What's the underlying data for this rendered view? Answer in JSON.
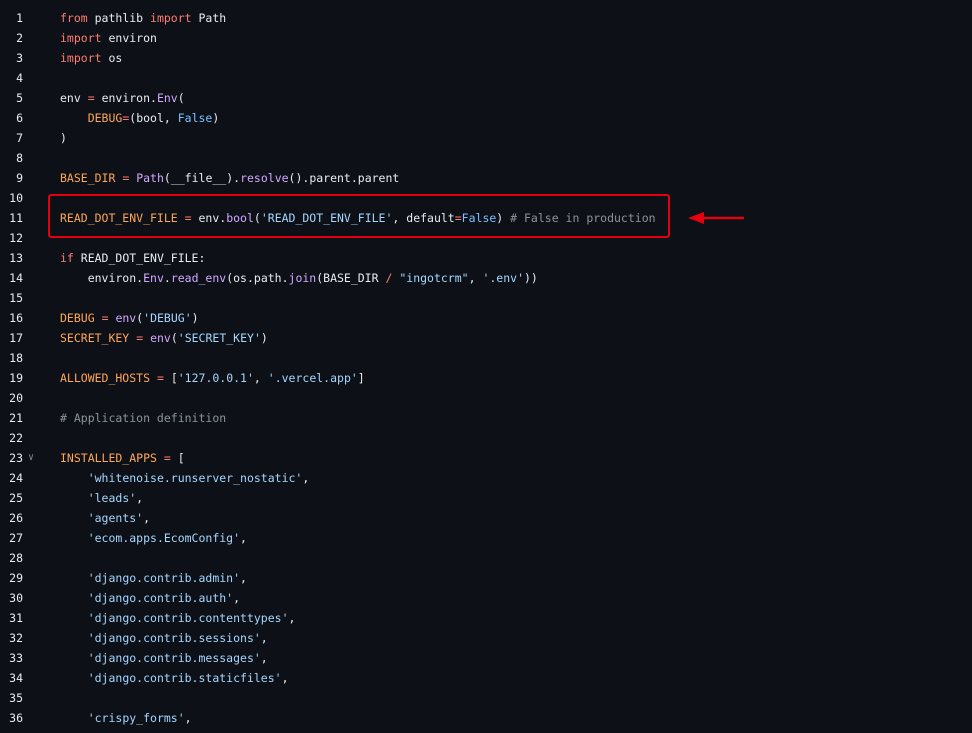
{
  "lines": [
    {
      "n": "1",
      "t": [
        [
          "kw",
          "from"
        ],
        [
          "plain",
          " pathlib "
        ],
        [
          "kw",
          "import"
        ],
        [
          "plain",
          " Path"
        ]
      ]
    },
    {
      "n": "2",
      "t": [
        [
          "kw",
          "import"
        ],
        [
          "plain",
          " environ"
        ]
      ]
    },
    {
      "n": "3",
      "t": [
        [
          "kw",
          "import"
        ],
        [
          "plain",
          " os"
        ]
      ]
    },
    {
      "n": "4",
      "t": []
    },
    {
      "n": "5",
      "t": [
        [
          "plain",
          "env "
        ],
        [
          "op",
          "="
        ],
        [
          "plain",
          " environ."
        ],
        [
          "fn",
          "Env"
        ],
        [
          "plain",
          "("
        ]
      ]
    },
    {
      "n": "6",
      "t": [
        [
          "plain",
          "    "
        ],
        [
          "var",
          "DEBUG"
        ],
        [
          "op",
          "="
        ],
        [
          "plain",
          "(bool, "
        ],
        [
          "cst",
          "False"
        ],
        [
          "plain",
          ")"
        ]
      ]
    },
    {
      "n": "7",
      "t": [
        [
          "plain",
          ")"
        ]
      ]
    },
    {
      "n": "8",
      "t": []
    },
    {
      "n": "9",
      "t": [
        [
          "var",
          "BASE_DIR"
        ],
        [
          "plain",
          " "
        ],
        [
          "op",
          "="
        ],
        [
          "plain",
          " "
        ],
        [
          "fn",
          "Path"
        ],
        [
          "plain",
          "(__file__)."
        ],
        [
          "fn",
          "resolve"
        ],
        [
          "plain",
          "().parent.parent"
        ]
      ]
    },
    {
      "n": "10",
      "t": []
    },
    {
      "n": "11",
      "t": [
        [
          "var",
          "READ_DOT_ENV_FILE"
        ],
        [
          "plain",
          " "
        ],
        [
          "op",
          "="
        ],
        [
          "plain",
          " env."
        ],
        [
          "fn",
          "bool"
        ],
        [
          "plain",
          "("
        ],
        [
          "str",
          "'READ_DOT_ENV_FILE'"
        ],
        [
          "plain",
          ", "
        ],
        [
          "plain",
          "default"
        ],
        [
          "op",
          "="
        ],
        [
          "cst",
          "False"
        ],
        [
          "plain",
          ") "
        ],
        [
          "com",
          "# False in production"
        ]
      ]
    },
    {
      "n": "12",
      "t": []
    },
    {
      "n": "13",
      "t": [
        [
          "kw",
          "if"
        ],
        [
          "plain",
          " READ_DOT_ENV_FILE:"
        ]
      ]
    },
    {
      "n": "14",
      "t": [
        [
          "plain",
          "    environ."
        ],
        [
          "fn",
          "Env"
        ],
        [
          "plain",
          "."
        ],
        [
          "fn",
          "read_env"
        ],
        [
          "plain",
          "(os.path."
        ],
        [
          "fn",
          "join"
        ],
        [
          "plain",
          "(BASE_DIR "
        ],
        [
          "op",
          "/"
        ],
        [
          "plain",
          " "
        ],
        [
          "str",
          "\"ingotcrm\""
        ],
        [
          "plain",
          ", "
        ],
        [
          "str",
          "'.env'"
        ],
        [
          "plain",
          "))"
        ]
      ]
    },
    {
      "n": "15",
      "t": []
    },
    {
      "n": "16",
      "t": [
        [
          "var",
          "DEBUG"
        ],
        [
          "plain",
          " "
        ],
        [
          "op",
          "="
        ],
        [
          "plain",
          " "
        ],
        [
          "fn",
          "env"
        ],
        [
          "plain",
          "("
        ],
        [
          "str",
          "'DEBUG'"
        ],
        [
          "plain",
          ")"
        ]
      ]
    },
    {
      "n": "17",
      "t": [
        [
          "var",
          "SECRET_KEY"
        ],
        [
          "plain",
          " "
        ],
        [
          "op",
          "="
        ],
        [
          "plain",
          " "
        ],
        [
          "fn",
          "env"
        ],
        [
          "plain",
          "("
        ],
        [
          "str",
          "'SECRET_KEY'"
        ],
        [
          "plain",
          ")"
        ]
      ]
    },
    {
      "n": "18",
      "t": []
    },
    {
      "n": "19",
      "t": [
        [
          "var",
          "ALLOWED_HOSTS"
        ],
        [
          "plain",
          " "
        ],
        [
          "op",
          "="
        ],
        [
          "plain",
          " ["
        ],
        [
          "str",
          "'127.0.0.1'"
        ],
        [
          "plain",
          ", "
        ],
        [
          "str",
          "'.vercel.app'"
        ],
        [
          "plain",
          "]"
        ]
      ]
    },
    {
      "n": "20",
      "t": []
    },
    {
      "n": "21",
      "t": [
        [
          "com",
          "# Application definition"
        ]
      ]
    },
    {
      "n": "22",
      "t": []
    },
    {
      "n": "23",
      "fold": true,
      "t": [
        [
          "var",
          "INSTALLED_APPS"
        ],
        [
          "plain",
          " "
        ],
        [
          "op",
          "="
        ],
        [
          "plain",
          " ["
        ]
      ]
    },
    {
      "n": "24",
      "t": [
        [
          "plain",
          "    "
        ],
        [
          "str",
          "'whitenoise.runserver_nostatic'"
        ],
        [
          "plain",
          ","
        ]
      ]
    },
    {
      "n": "25",
      "t": [
        [
          "plain",
          "    "
        ],
        [
          "str",
          "'leads'"
        ],
        [
          "plain",
          ","
        ]
      ]
    },
    {
      "n": "26",
      "t": [
        [
          "plain",
          "    "
        ],
        [
          "str",
          "'agents'"
        ],
        [
          "plain",
          ","
        ]
      ]
    },
    {
      "n": "27",
      "t": [
        [
          "plain",
          "    "
        ],
        [
          "str",
          "'ecom.apps.EcomConfig'"
        ],
        [
          "plain",
          ","
        ]
      ]
    },
    {
      "n": "28",
      "t": []
    },
    {
      "n": "29",
      "t": [
        [
          "plain",
          "    "
        ],
        [
          "str",
          "'django.contrib.admin'"
        ],
        [
          "plain",
          ","
        ]
      ]
    },
    {
      "n": "30",
      "t": [
        [
          "plain",
          "    "
        ],
        [
          "str",
          "'django.contrib.auth'"
        ],
        [
          "plain",
          ","
        ]
      ]
    },
    {
      "n": "31",
      "t": [
        [
          "plain",
          "    "
        ],
        [
          "str",
          "'django.contrib.contenttypes'"
        ],
        [
          "plain",
          ","
        ]
      ]
    },
    {
      "n": "32",
      "t": [
        [
          "plain",
          "    "
        ],
        [
          "str",
          "'django.contrib.sessions'"
        ],
        [
          "plain",
          ","
        ]
      ]
    },
    {
      "n": "33",
      "t": [
        [
          "plain",
          "    "
        ],
        [
          "str",
          "'django.contrib.messages'"
        ],
        [
          "plain",
          ","
        ]
      ]
    },
    {
      "n": "34",
      "t": [
        [
          "plain",
          "    "
        ],
        [
          "str",
          "'django.contrib.staticfiles'"
        ],
        [
          "plain",
          ","
        ]
      ]
    },
    {
      "n": "35",
      "t": []
    },
    {
      "n": "36",
      "t": [
        [
          "plain",
          "    "
        ],
        [
          "str",
          "'crispy_forms'"
        ],
        [
          "plain",
          ","
        ]
      ]
    }
  ],
  "colors": {
    "highlight": "#e3000f",
    "background": "#0d1117"
  },
  "icons": {
    "fold": "chevron-down-icon",
    "arrow": "arrow-left-icon"
  }
}
